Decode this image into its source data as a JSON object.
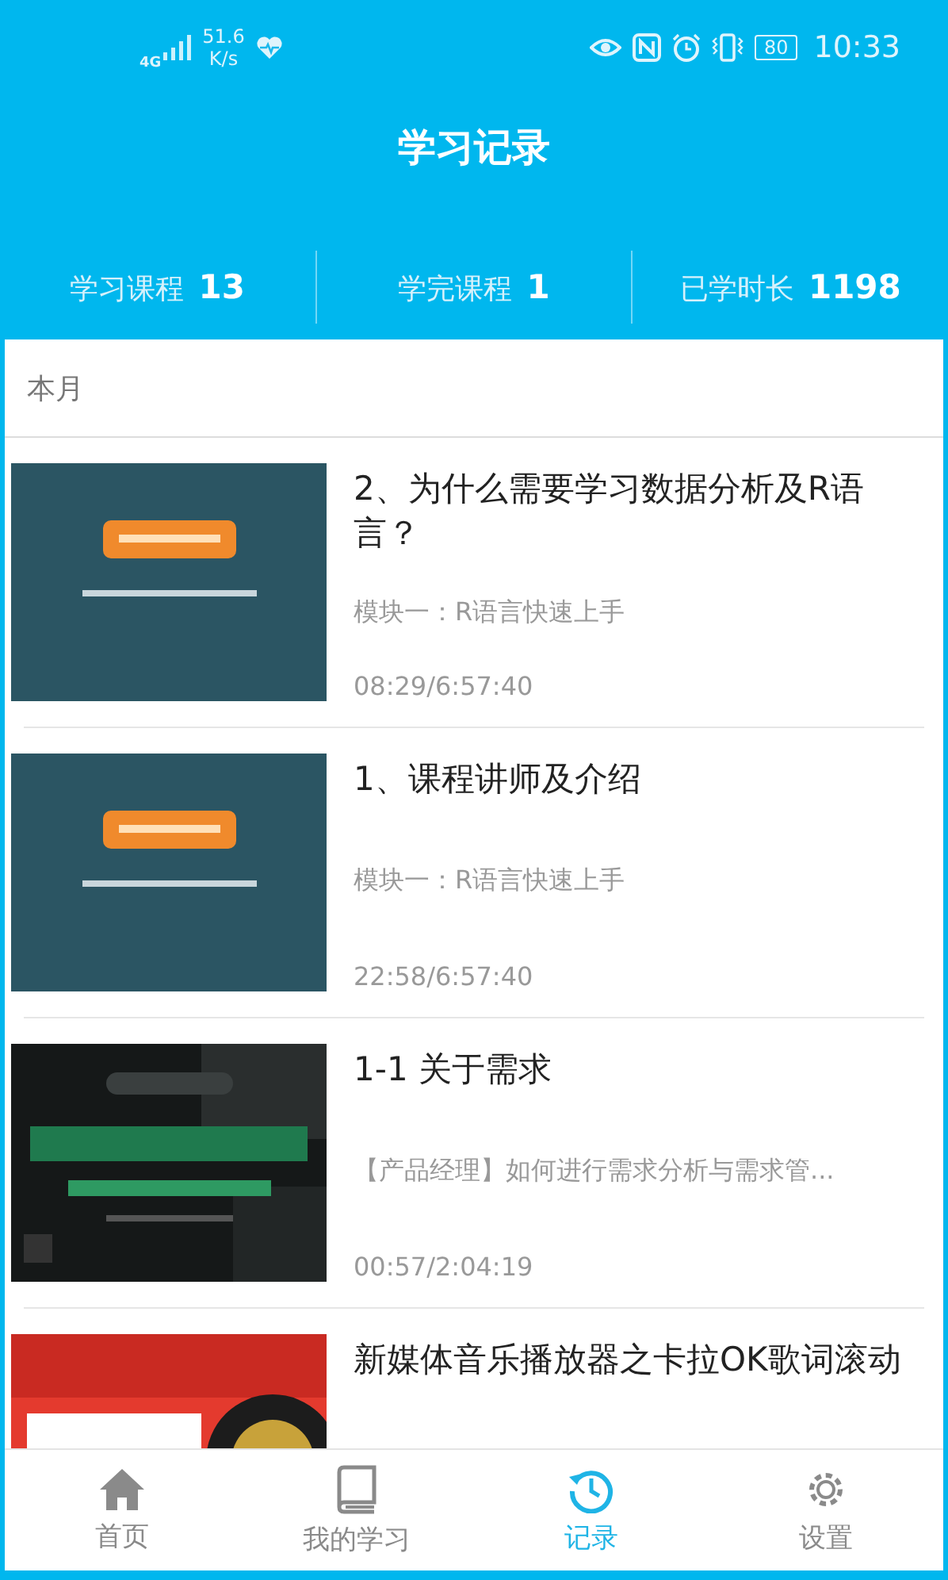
{
  "status_bar": {
    "network": "4G",
    "speed_value": "51.6",
    "speed_unit": "K/s",
    "battery": "80",
    "time": "10:33"
  },
  "header": {
    "title": "学习记录"
  },
  "stats": [
    {
      "label": "学习课程",
      "value": "13"
    },
    {
      "label": "学完课程",
      "value": "1"
    },
    {
      "label": "已学时长",
      "value": "1198"
    }
  ],
  "section": {
    "title": "本月"
  },
  "records": [
    {
      "title": "2、为什么需要学习数据分析及R语言？",
      "subtitle": "模块一：R语言快速上手",
      "progress": "08:29/6:57:40"
    },
    {
      "title": "1、课程讲师及介绍",
      "subtitle": "模块一：R语言快速上手",
      "progress": "22:58/6:57:40"
    },
    {
      "title": "1-1 关于需求",
      "subtitle": "【产品经理】如何进行需求分析与需求管...",
      "progress": "00:57/2:04:19"
    },
    {
      "title": "新媒体音乐播放器之卡拉OK歌词滚动"
    }
  ],
  "tabs": [
    {
      "label": "首页",
      "selected": false
    },
    {
      "label": "我的学习",
      "selected": false
    },
    {
      "label": "记录",
      "selected": true
    },
    {
      "label": "设置",
      "selected": false
    }
  ]
}
